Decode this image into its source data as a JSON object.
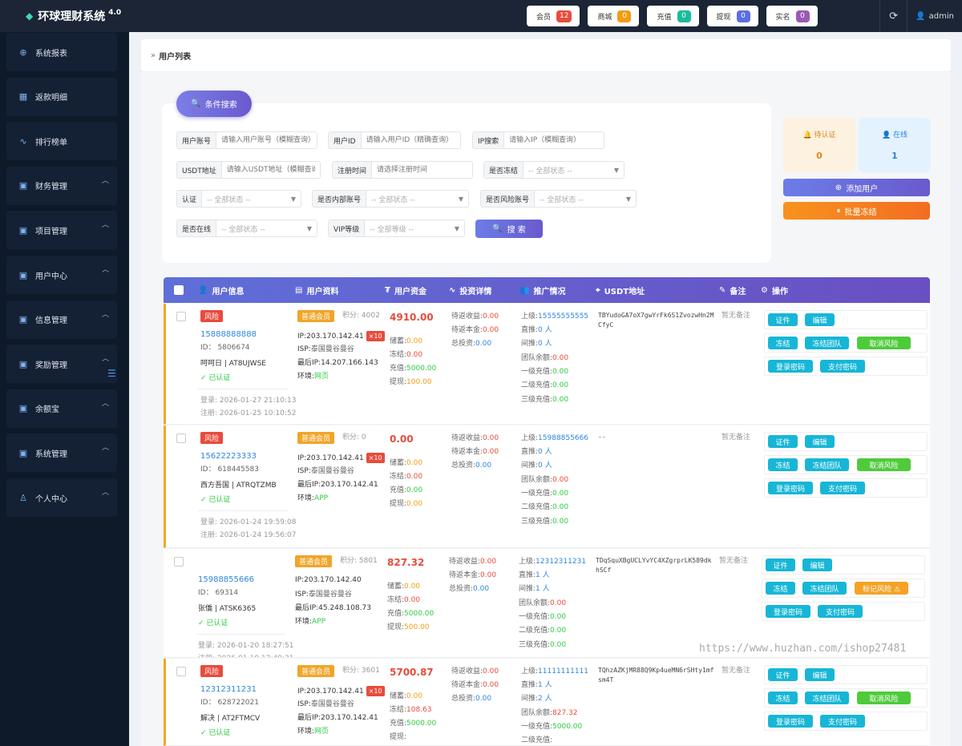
{
  "app": {
    "title": "环球理财系统",
    "version": "4.0"
  },
  "topbar": {
    "badges": [
      {
        "label": "会员",
        "count": "12",
        "color": "#e74c3c"
      },
      {
        "label": "商城",
        "count": "0",
        "color": "#f39c12"
      },
      {
        "label": "充值",
        "count": "0",
        "color": "#1abc9c"
      },
      {
        "label": "提现",
        "count": "0",
        "color": "#5b6ee1"
      },
      {
        "label": "实名",
        "count": "0",
        "color": "#9b59b6"
      }
    ],
    "user": "admin"
  },
  "sidebar": {
    "items": [
      {
        "label": "系统报表",
        "icon": "globe-icon",
        "expandable": false
      },
      {
        "label": "返款明细",
        "icon": "calendar-icon",
        "expandable": false
      },
      {
        "label": "排行榜单",
        "icon": "pulse-icon",
        "expandable": false
      },
      {
        "label": "财务管理",
        "icon": "apps-icon",
        "expandable": true
      },
      {
        "label": "项目管理",
        "icon": "apps-icon",
        "expandable": true
      },
      {
        "label": "用户中心",
        "icon": "apps-icon",
        "expandable": true
      },
      {
        "label": "信息管理",
        "icon": "apps-icon",
        "expandable": true
      },
      {
        "label": "奖励管理",
        "icon": "apps-icon",
        "expandable": true
      },
      {
        "label": "余额宝",
        "icon": "apps-icon",
        "expandable": true
      },
      {
        "label": "系统管理",
        "icon": "apps-icon",
        "expandable": true
      },
      {
        "label": "个人中心",
        "icon": "user-icon",
        "expandable": true
      }
    ]
  },
  "page": {
    "title": "用户列表"
  },
  "search": {
    "toggle_label": "条件搜索",
    "account_label": "用户账号",
    "account_placeholder": "请输入用户账号（模糊查询）",
    "uid_label": "用户ID",
    "uid_placeholder": "请输入用户ID（精确查询）",
    "ip_label": "IP搜索",
    "ip_placeholder": "请输入IP（模糊查询）",
    "usdt_label": "USDT地址",
    "usdt_placeholder": "请输入USDT地址（模糊查询）",
    "regtime_label": "注册时间",
    "regtime_placeholder": "请选择注册时间",
    "frozen_label": "是否冻结",
    "frozen_value": "-- 全部状态 --",
    "auth_label": "认证",
    "auth_value": "-- 全部状态 --",
    "internal_label": "是否内部账号",
    "internal_value": "-- 全部状态 --",
    "riskacct_label": "是否风险账号",
    "riskacct_value": "-- 全部状态 --",
    "online_label": "是否在线",
    "online_value": "-- 全部状态 --",
    "vip_label": "VIP等级",
    "vip_value": "-- 全部等级 --",
    "search_button": "搜 索"
  },
  "stats": {
    "pending": {
      "label": "待认证",
      "value": "0"
    },
    "online": {
      "label": "在线",
      "value": "1"
    }
  },
  "actions": {
    "add_user": "添加用户",
    "batch_freeze": "批量冻结"
  },
  "table": {
    "headers": [
      "用户信息",
      "用户资料",
      "用户资金",
      "投资详情",
      "推广情况",
      "USDT地址",
      "备注",
      "操作"
    ]
  },
  "rows": [
    {
      "risk": "风险",
      "phone": "15888888888",
      "id": "ID： 5806674",
      "name": "呵呵日 | AT8UJWSE",
      "verified": "✓ 已认证",
      "login": "登录: 2026-01-27 21:10:13",
      "register": "注册: 2026-01-25 10:10:52",
      "vip": "普通会员",
      "points": "积分: 4002",
      "ip": "IP:203.170.142.41",
      "x10": "×10",
      "isp_pre": "ISP:",
      "isp": "泰国曼谷曼谷",
      "last_ip": "最后IP:14.207.166.143",
      "env_pre": "环境:",
      "env": "网页",
      "money": "4910.00",
      "savings": "0.00",
      "frozen": "0.00",
      "recharge": "5000.00",
      "withdraw": "100.00",
      "pending_income": "0.00",
      "pending_principal": "0.00",
      "total_invest": "0.00",
      "upline": "15555555555",
      "direct": "0 人",
      "indirect": "0 人",
      "team_balance": "0.00",
      "l1": "0.00",
      "l2": "0.00",
      "l3": "0.00",
      "usdt": "TBYudoGA7oX7gwYrFk6S1ZvozwHn2MCfyC",
      "remark": "暂无备注",
      "risk_btn": "取消风险"
    },
    {
      "risk": "风险",
      "phone": "15622223333",
      "id": "ID： 618445583",
      "name": "西方吾国 | ATRQTZMB",
      "verified": "✓ 已认证",
      "login": "登录: 2026-01-24 19:59:08",
      "register": "注册: 2026-01-24 19:56:07",
      "vip": "普通会员",
      "points": "积分: 0",
      "ip": "IP:203.170.142.41",
      "x10": "×10",
      "isp_pre": "ISP:",
      "isp": "泰国曼谷曼谷",
      "last_ip": "最后IP:203.170.142.41",
      "env_pre": "环境:",
      "env": "APP",
      "money": "0.00",
      "savings": "0.00",
      "frozen": "0.00",
      "recharge": "0.00",
      "withdraw": "0.00",
      "pending_income": "0.00",
      "pending_principal": "0.00",
      "total_invest": "0.00",
      "upline": "15988855666",
      "direct": "0 人",
      "indirect": "0 人",
      "team_balance": "0.00",
      "l1": "0.00",
      "l2": "0.00",
      "l3": "0.00",
      "usdt": "--",
      "remark": "暂无备注",
      "risk_btn": "取消风险"
    },
    {
      "risk": "",
      "phone": "15988855666",
      "id": "ID： 69314",
      "name": "张僑 | ATSK6365",
      "verified": "✓ 已认证",
      "login": "登录: 2026-01-20 18:27:51",
      "register": "注册: 2026-01-19 17:49:31",
      "vip": "普通会员",
      "points": "积分: 5801",
      "ip": "IP:203.170.142.40",
      "x10": "",
      "isp_pre": "ISP:",
      "isp": "泰国曼谷曼谷",
      "last_ip": "最后IP:45.248.108.73",
      "env_pre": "环境:",
      "env": "APP",
      "money": "827.32",
      "savings": "0.00",
      "frozen": "0.00",
      "recharge": "5000.00",
      "withdraw": "500.00",
      "pending_income": "0.00",
      "pending_principal": "0.00",
      "total_invest": "0.00",
      "upline": "12312311231",
      "direct": "1 人",
      "indirect": "1 人",
      "team_balance": "0.00",
      "l1": "0.00",
      "l2": "0.00",
      "l3": "0.00",
      "usdt": "TDqSquXBgUCLYvYC4XZgrprLK589dkhSCf",
      "remark": "暂无备注",
      "risk_btn": "标记风险 ⚠"
    },
    {
      "risk": "风险",
      "phone": "12312311231",
      "id": "ID： 628722021",
      "name": "解决 | AT2FTMCV",
      "verified": "✓ 已认证",
      "login": "",
      "register": "",
      "vip": "普通会员",
      "points": "积分: 3601",
      "ip": "IP:203.170.142.41",
      "x10": "×10",
      "isp_pre": "ISP:",
      "isp": "泰国曼谷曼谷",
      "last_ip": "最后IP:203.170.142.41",
      "env_pre": "环境:",
      "env": "网页",
      "money": "5700.87",
      "savings": "0.00",
      "frozen": "108.63",
      "recharge": "5000.00",
      "withdraw": "",
      "pending_income": "0.00",
      "pending_principal": "0.00",
      "total_invest": "0.00",
      "upline": "11111111111",
      "direct": "1 人",
      "indirect": "2 人",
      "team_balance": "827.32",
      "l1": "5000.00",
      "l2": "",
      "l3": "",
      "usdt": "TQhzAZKjMR88Q9Kp4ueMN6rSHty1mfsm4T",
      "remark": "暂无备注",
      "risk_btn": "取消风险"
    }
  ],
  "labels": {
    "savings": "储蓄:",
    "frozen": "冻结:",
    "recharge": "充值:",
    "withdraw": "提现:",
    "pending_income": "待返收益:",
    "pending_principal": "待返本金:",
    "total_invest": "总投资:",
    "upline": "上级:",
    "direct": "直推:",
    "indirect": "间推:",
    "team_balance": "团队余额:",
    "l1": "一级充值:",
    "l2": "二级充值:",
    "l3": "三级充值:",
    "btn_cert": "证件",
    "btn_edit": "编辑",
    "btn_freeze": "冻结",
    "btn_freeze_team": "冻结团队",
    "btn_login_pwd": "登录密码",
    "btn_pay_pwd": "支付密码"
  },
  "watermark": "https://www.huzhan.com/ishop27481"
}
